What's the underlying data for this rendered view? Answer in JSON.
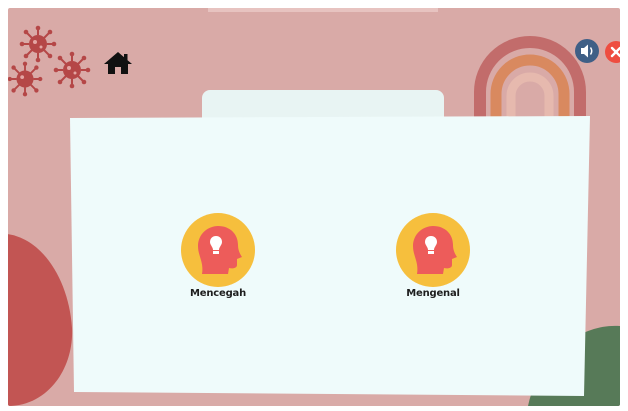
{
  "header": {
    "home_icon": "home-icon",
    "sound_icon": "speaker-icon",
    "close_icon": "close-icon"
  },
  "menu": {
    "items": [
      {
        "label": "Mencegah",
        "icon": "head-lightbulb-icon"
      },
      {
        "label": "Mengenal",
        "icon": "head-lightbulb-icon"
      }
    ]
  },
  "colors": {
    "background": "#d8a9a5",
    "panel": "#effbfb",
    "icon_circle": "#f6c03f",
    "icon_head": "#ee5c5c",
    "rainbow_outer": "#c96b6b",
    "rainbow_inner": "#d98a5c",
    "virus": "#b64848",
    "close_button": "#ef4d42"
  }
}
